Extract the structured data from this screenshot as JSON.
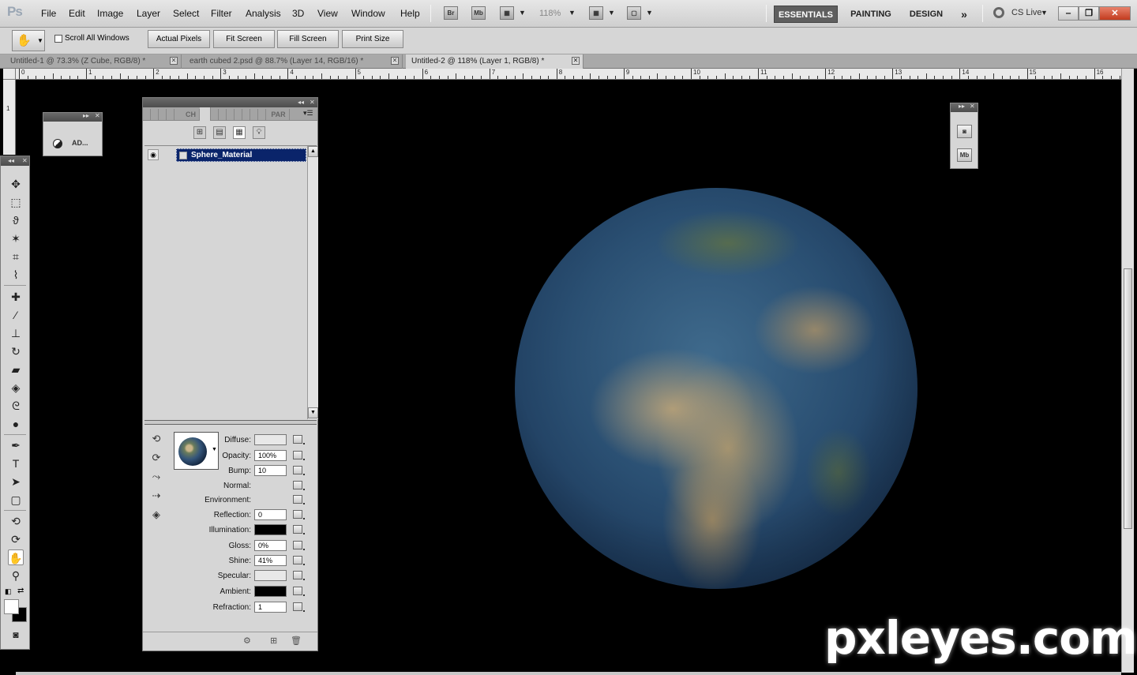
{
  "app": {
    "logo": "Ps"
  },
  "menu": [
    "File",
    "Edit",
    "Image",
    "Layer",
    "Select",
    "Filter",
    "Analysis",
    "3D",
    "View",
    "Window",
    "Help"
  ],
  "appbar": {
    "bridge": "Br",
    "minibridge": "Mb",
    "zoom": "118%"
  },
  "workspaces": [
    "ESSENTIALS",
    "PAINTING",
    "DESIGN"
  ],
  "cslive": "CS Live",
  "options": {
    "scroll_all": "Scroll All Windows",
    "buttons": [
      "Actual Pixels",
      "Fit Screen",
      "Fill Screen",
      "Print Size"
    ]
  },
  "doc_tabs": [
    "Untitled-1 @ 73.3% (Z Cube, RGB/8) *",
    "earth cubed 2.psd @ 88.7% (Layer 14, RGB/16) *",
    "Untitled-2 @ 118% (Layer 1, RGB/8) *"
  ],
  "ruler": [
    "0",
    "1",
    "2",
    "3",
    "4",
    "5",
    "6",
    "7",
    "8",
    "9",
    "10",
    "11",
    "12",
    "13",
    "14",
    "15",
    "16"
  ],
  "ruler_v": [
    "1"
  ],
  "adj_panel": {
    "label": "AD..."
  },
  "panel3d": {
    "tabs": [
      "CH",
      "PAR"
    ],
    "material_name": "Sphere_Material",
    "properties": [
      {
        "label": "Diffuse:",
        "value": "",
        "kind": "light"
      },
      {
        "label": "Opacity:",
        "value": "100%",
        "kind": "text"
      },
      {
        "label": "Bump:",
        "value": "10",
        "kind": "text"
      },
      {
        "label": "Normal:",
        "value": "",
        "kind": "none"
      },
      {
        "label": "Environment:",
        "value": "",
        "kind": "none"
      },
      {
        "label": "Reflection:",
        "value": "0",
        "kind": "text"
      },
      {
        "label": "Illumination:",
        "value": "",
        "kind": "dark"
      },
      {
        "label": "Gloss:",
        "value": "0%",
        "kind": "text"
      },
      {
        "label": "Shine:",
        "value": "41%",
        "kind": "text"
      },
      {
        "label": "Specular:",
        "value": "",
        "kind": "light"
      },
      {
        "label": "Ambient:",
        "value": "",
        "kind": "dark"
      },
      {
        "label": "Refraction:",
        "value": "1",
        "kind": "text"
      }
    ]
  },
  "mini_panel": {
    "btn2": "Mb"
  },
  "watermark": "pxleyes.com"
}
